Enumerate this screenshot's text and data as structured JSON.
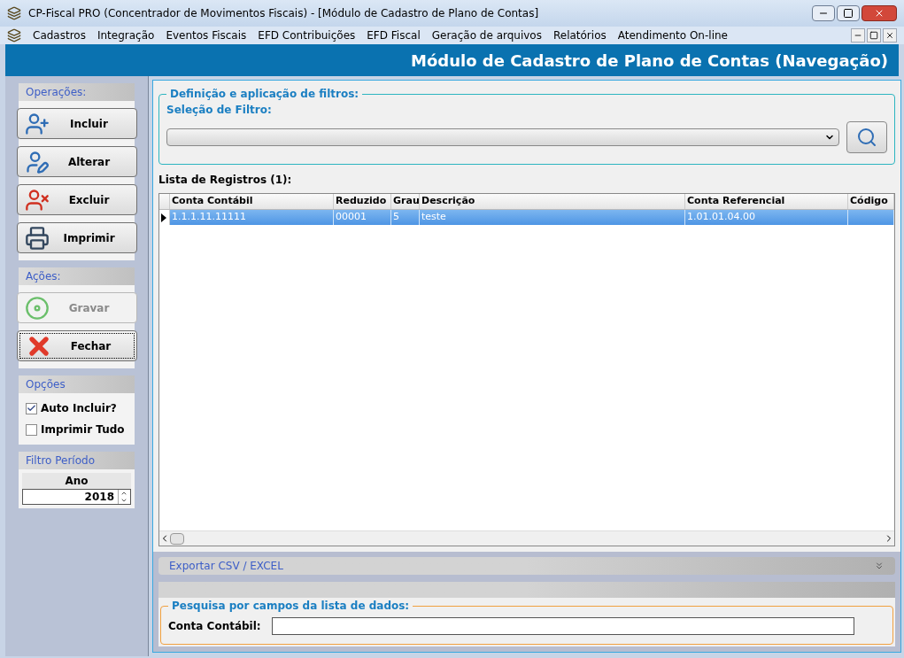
{
  "window": {
    "title": "CP-Fiscal PRO (Concentrador de Movimentos Fiscais) - [Módulo de Cadastro de Plano de Contas]"
  },
  "menu": [
    "Cadastros",
    "Integração",
    "Eventos Fiscais",
    "EFD Contribuições",
    "EFD Fiscal",
    "Geração de arquivos",
    "Relatórios",
    "Atendimento On-line"
  ],
  "header": {
    "title": "Módulo de Cadastro de Plano de Contas (Navegação)"
  },
  "sidebar": {
    "operations": {
      "title": "Operações:",
      "buttons": [
        {
          "label": "Incluir",
          "kind": "add",
          "disabled": false,
          "focused": false
        },
        {
          "label": "Alterar",
          "kind": "edit",
          "disabled": false,
          "focused": false
        },
        {
          "label": "Excluir",
          "kind": "delete",
          "disabled": false,
          "focused": false
        },
        {
          "label": "Imprimir",
          "kind": "print",
          "disabled": false,
          "focused": false
        }
      ]
    },
    "actions": {
      "title": "Ações:",
      "buttons": [
        {
          "label": "Gravar",
          "kind": "save",
          "disabled": true,
          "focused": false
        },
        {
          "label": "Fechar",
          "kind": "close",
          "disabled": false,
          "focused": true
        }
      ]
    },
    "options": {
      "title": "Opções",
      "checkboxes": [
        {
          "label": "Auto Incluir?",
          "checked": true
        },
        {
          "label": "Imprimir Tudo",
          "checked": false
        }
      ]
    },
    "period": {
      "title": "Filtro Período",
      "label": "Ano",
      "value": "2018"
    }
  },
  "filters": {
    "title": "Definição e aplicação de filtros:",
    "label": "Seleção de Filtro:"
  },
  "table": {
    "title": "Lista de Registros (1):",
    "columns": [
      "Conta Contábil",
      "Reduzido",
      "Grau",
      "Descrição",
      "Conta Referencial",
      "Código"
    ],
    "rows": [
      {
        "cells": [
          "1.1.1.11.11111",
          "00001",
          "5",
          "teste",
          "1.01.01.04.00",
          ""
        ],
        "selected": true
      }
    ]
  },
  "export": {
    "label": "Exportar CSV / EXCEL"
  },
  "search": {
    "title": "Pesquisa por campos da lista de dados:",
    "label": "Conta Contábil:"
  }
}
